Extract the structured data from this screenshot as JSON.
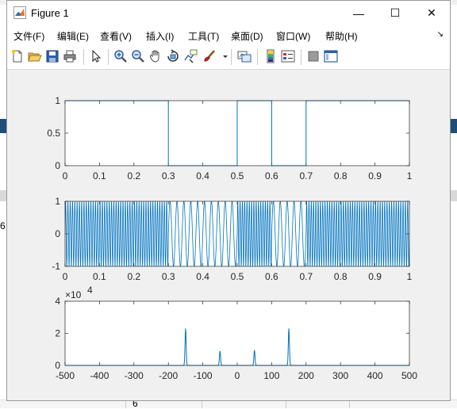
{
  "window": {
    "title": "Figure 1",
    "minimize_glyph": "—",
    "maximize_glyph": "☐",
    "close_glyph": "✕"
  },
  "menu": {
    "items": [
      {
        "label": "文件(F)",
        "key": "F"
      },
      {
        "label": "编辑(E)",
        "key": "E"
      },
      {
        "label": "查看(V)",
        "key": "V"
      },
      {
        "label": "插入(I)",
        "key": "I"
      },
      {
        "label": "工具(T)",
        "key": "T"
      },
      {
        "label": "桌面(D)",
        "key": "D"
      },
      {
        "label": "窗口(W)",
        "key": "W"
      },
      {
        "label": "帮助(H)",
        "key": "H"
      }
    ],
    "more_glyph": "↘"
  },
  "toolbar": {
    "tools": [
      {
        "name": "new-figure-icon"
      },
      {
        "name": "open-file-icon"
      },
      {
        "name": "save-icon"
      },
      {
        "name": "print-icon"
      },
      {
        "name": "edit-plot-arrow-icon"
      },
      {
        "name": "zoom-in-icon"
      },
      {
        "name": "zoom-out-icon"
      },
      {
        "name": "pan-hand-icon"
      },
      {
        "name": "rotate-3d-icon"
      },
      {
        "name": "data-cursor-icon"
      },
      {
        "name": "brush-icon"
      },
      {
        "name": "link-plot-icon"
      },
      {
        "name": "insert-colorbar-icon"
      },
      {
        "name": "insert-legend-icon"
      },
      {
        "name": "hide-plot-tools-icon"
      },
      {
        "name": "show-plot-tools-icon"
      }
    ]
  },
  "background": {
    "left_digit": "6",
    "bottom_digit": "6"
  },
  "colors": {
    "line": "#0072bd",
    "axes_bg": "#ffffff",
    "figure_bg": "#f0f0f0",
    "axis_color": "#262626"
  },
  "chart_data": [
    {
      "type": "line",
      "title": "",
      "xlabel": "",
      "ylabel": "",
      "xlim": [
        0,
        1
      ],
      "ylim": [
        0,
        1
      ],
      "xticks": [
        "0",
        "0.1",
        "0.2",
        "0.3",
        "0.4",
        "0.5",
        "0.6",
        "0.7",
        "0.8",
        "0.9",
        "1"
      ],
      "yticks": [
        "0",
        "0.5",
        "1"
      ],
      "series": [
        {
          "x": [
            0,
            0.3,
            0.3,
            0.5,
            0.5,
            0.6,
            0.6,
            0.7,
            0.7,
            1
          ],
          "y": [
            1,
            1,
            0,
            0,
            1,
            1,
            0,
            0,
            1,
            1
          ]
        }
      ]
    },
    {
      "type": "line",
      "title": "",
      "xlabel": "",
      "ylabel": "",
      "xlim": [
        0,
        1
      ],
      "ylim": [
        -1,
        1
      ],
      "xticks": [
        "0",
        "0.1",
        "0.2",
        "0.3",
        "0.4",
        "0.5",
        "0.6",
        "0.7",
        "0.8",
        "0.9",
        "1"
      ],
      "yticks": [
        "-1",
        "0",
        "1"
      ],
      "series": [
        {
          "segments": [
            {
              "x0": 0,
              "x1": 0.3,
              "freq_hz": 150
            },
            {
              "x0": 0.3,
              "x1": 0.5,
              "freq_hz": 50
            },
            {
              "x0": 0.5,
              "x1": 0.6,
              "freq_hz": 150
            },
            {
              "x0": 0.6,
              "x1": 0.7,
              "freq_hz": 50
            },
            {
              "x0": 0.7,
              "x1": 1,
              "freq_hz": 150
            }
          ]
        }
      ]
    },
    {
      "type": "line",
      "title": "",
      "xlabel": "",
      "ylabel": "",
      "xlim": [
        -500,
        500
      ],
      "ylim": [
        0,
        40000
      ],
      "exponent_label": "×10",
      "exponent_value": "4",
      "xticks": [
        "-500",
        "-400",
        "-300",
        "-200",
        "-100",
        "0",
        "100",
        "200",
        "300",
        "400",
        "500"
      ],
      "yticks": [
        "0",
        "2",
        "4"
      ],
      "series": [
        {
          "peaks": [
            {
              "x": -150,
              "y": 23000
            },
            {
              "x": -50,
              "y": 9000
            },
            {
              "x": 50,
              "y": 9500
            },
            {
              "x": 150,
              "y": 23000
            }
          ]
        }
      ]
    }
  ]
}
